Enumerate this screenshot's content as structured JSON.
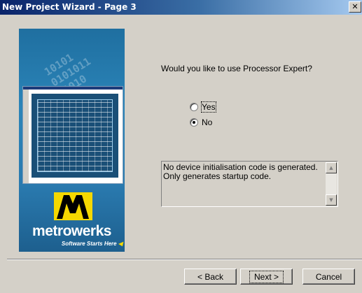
{
  "window": {
    "title": "New Project Wizard - Page  3",
    "close_icon": "close-icon"
  },
  "banner": {
    "binary_text": "10101\n0101011\n01010\n10101",
    "logo_word": "metrowerks",
    "logo_tagline": "Software Starts Here"
  },
  "main": {
    "question": "Would you like to use Processor Expert?",
    "options": [
      {
        "label": "Yes",
        "selected": false
      },
      {
        "label": "No",
        "selected": true
      }
    ],
    "description": "No device initialisation code is generated. Only generates startup code."
  },
  "buttons": {
    "back": "< Back",
    "next": "Next >",
    "cancel": "Cancel"
  },
  "colors": {
    "face": "#d4d0c8",
    "title_start": "#0a246a",
    "title_end": "#a6caf0",
    "logo_yellow": "#f5d800"
  }
}
